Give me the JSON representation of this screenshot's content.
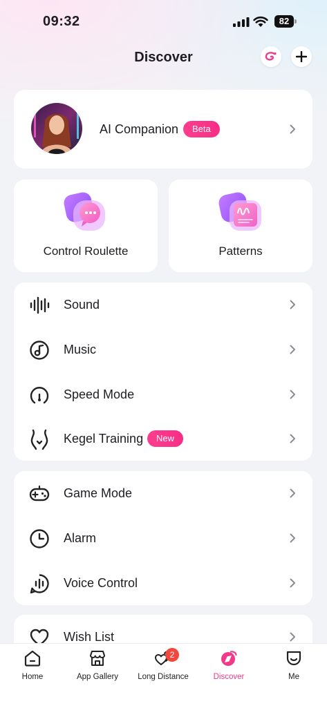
{
  "status_bar": {
    "time": "09:32",
    "battery": "82"
  },
  "header": {
    "title": "Discover"
  },
  "ai_companion": {
    "label": "AI Companion",
    "badge": "Beta"
  },
  "features": [
    {
      "label": "Control Roulette",
      "icon": "chat-bubble-icon"
    },
    {
      "label": "Patterns",
      "icon": "waveform-sheet-icon"
    }
  ],
  "list_group_1": [
    {
      "label": "Sound",
      "icon": "sound-wave-icon"
    },
    {
      "label": "Music",
      "icon": "music-disc-icon"
    },
    {
      "label": "Speed Mode",
      "icon": "speedometer-icon"
    },
    {
      "label": "Kegel Training",
      "icon": "pelvis-icon",
      "badge": "New"
    }
  ],
  "list_group_2": [
    {
      "label": "Game Mode",
      "icon": "gamepad-icon"
    },
    {
      "label": "Alarm",
      "icon": "clock-icon"
    },
    {
      "label": "Voice Control",
      "icon": "voice-icon"
    }
  ],
  "list_group_3": [
    {
      "label": "Wish List",
      "icon": "heart-icon"
    }
  ],
  "tabs": [
    {
      "label": "Home",
      "icon": "home-icon"
    },
    {
      "label": "App Gallery",
      "icon": "store-icon"
    },
    {
      "label": "Long Distance",
      "icon": "hearts-icon",
      "badge": "2"
    },
    {
      "label": "Discover",
      "icon": "discover-icon",
      "active": true
    },
    {
      "label": "Me",
      "icon": "face-icon"
    }
  ],
  "colors": {
    "accent": "#f23a8a",
    "background": "#f2f3f6",
    "card": "#ffffff"
  }
}
